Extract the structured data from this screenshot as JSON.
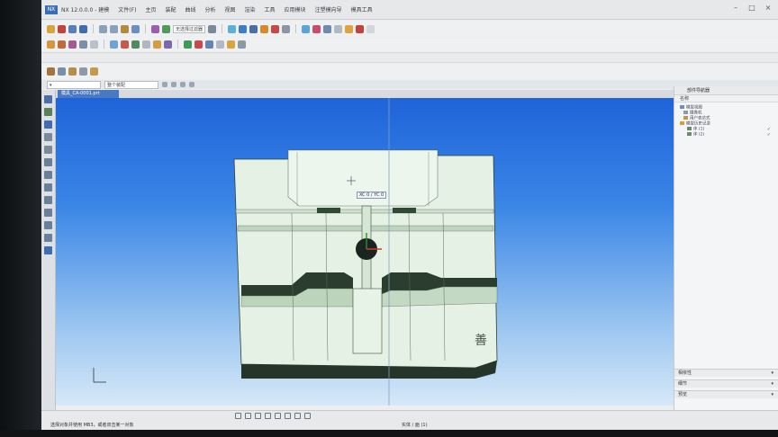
{
  "app": {
    "logo": "NX",
    "title": "NX 12.0.0.0 - 建模",
    "menus": [
      "文件(F)",
      "主页",
      "装配",
      "曲线",
      "分析",
      "视图",
      "渲染",
      "工具",
      "应用模块",
      "注塑模向导",
      "模具工具"
    ]
  },
  "toolbar": {
    "layer_field": "无选择过滤器",
    "dropdown": "整个装配"
  },
  "document_tab": "模具_CA-0001.prt",
  "coordinate_label": "XC 0 / YC 0",
  "part_text": "善",
  "navigator": {
    "title": "部件导航器",
    "header": "名称",
    "rows": [
      {
        "text": "模型视图",
        "check": ""
      },
      {
        "text": "摄像机",
        "check": ""
      },
      {
        "text": "用户表达式",
        "check": ""
      },
      {
        "text": "模型历史记录",
        "check": ""
      },
      {
        "text": "体 (1)",
        "check": "✓"
      },
      {
        "text": "体 (2)",
        "check": "✓"
      }
    ],
    "panels": [
      "相依性",
      "细节",
      "预览"
    ]
  },
  "status": {
    "left": "选择对象并使用 MB3，或者双击某一对象",
    "center": "实体 / 面 (1)"
  },
  "colors": {
    "viewport_top": "#1f63d9",
    "viewport_bottom": "#d6e8f8",
    "part_face": "#e6f2e6",
    "part_edge": "#2c3a2c"
  }
}
